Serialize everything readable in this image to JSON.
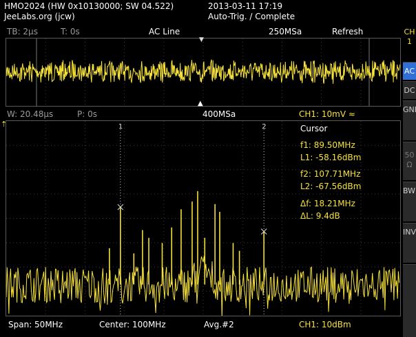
{
  "header": {
    "device_line1": "HMO2024 (HW 0x10130000; SW 04.522)",
    "device_line2": "JeeLabs.org (jcw)",
    "datetime": "2013-03-11 17:19",
    "status": "Auto-Trig. / Complete"
  },
  "time_bar": {
    "timebase": "TB: 2µs",
    "trigger_time": "T: 0s",
    "trigger_source": "AC Line",
    "sample_rate": "250MSa",
    "mode": "Refresh"
  },
  "fft_bar": {
    "window": "W: 20.48µs",
    "position": "P: 0s",
    "sample_rate": "400MSa",
    "channel_scale": "CH1: 10mV"
  },
  "cursor_panel": {
    "title": "Cursor",
    "f1": "f1: 89.50MHz",
    "l1": "L1: -58.16dBm",
    "f2": "f2: 107.71MHz",
    "l2": "L2: -67.56dBm",
    "df": "Δf: 18.21MHz",
    "dl": "ΔL: 9.4dB"
  },
  "cursor_markers": {
    "c1": "1",
    "c2": "2"
  },
  "footer": {
    "span": "Span: 50MHz",
    "center": "Center: 100MHz",
    "avg": "Avg.#2",
    "ch_scale": "CH1: 10dBm"
  },
  "side_menu": {
    "channel": "CH 1",
    "ac": "AC",
    "dc": "DC",
    "gnd": "GND",
    "fifty": "50 Ω",
    "bwl": "BWL",
    "inv": "INV"
  },
  "colors": {
    "trace": "#f6e23a",
    "accent": "#2f6fd6",
    "grid": "#3a3a3a",
    "frame": "#5b5b5b"
  },
  "chart_data": [
    {
      "type": "line",
      "title": "",
      "xlabel": "",
      "ylabel": "",
      "x_range_us": [
        -10,
        10
      ],
      "series": [
        {
          "description": "time-domain CH1 signal, amplitude-modulated noise burst pattern"
        }
      ]
    },
    {
      "type": "line",
      "title": "",
      "x": [
        75,
        80,
        85,
        89.5,
        92,
        95,
        98,
        100,
        102,
        104,
        107.71,
        110,
        115,
        120,
        125
      ],
      "x_unit": "MHz",
      "ylabel": "dBm",
      "series": [
        {
          "name": "CH1",
          "values": [
            -95,
            -92,
            -94,
            -58.16,
            -70,
            -68,
            -55,
            -48,
            -50,
            -60,
            -67.56,
            -88,
            -90,
            -92,
            -94
          ]
        }
      ],
      "cursors": [
        {
          "label": "1",
          "freq_mhz": 89.5,
          "level_dbm": -58.16
        },
        {
          "label": "2",
          "freq_mhz": 107.71,
          "level_dbm": -67.56
        }
      ],
      "span_mhz": 50,
      "center_mhz": 100
    }
  ]
}
